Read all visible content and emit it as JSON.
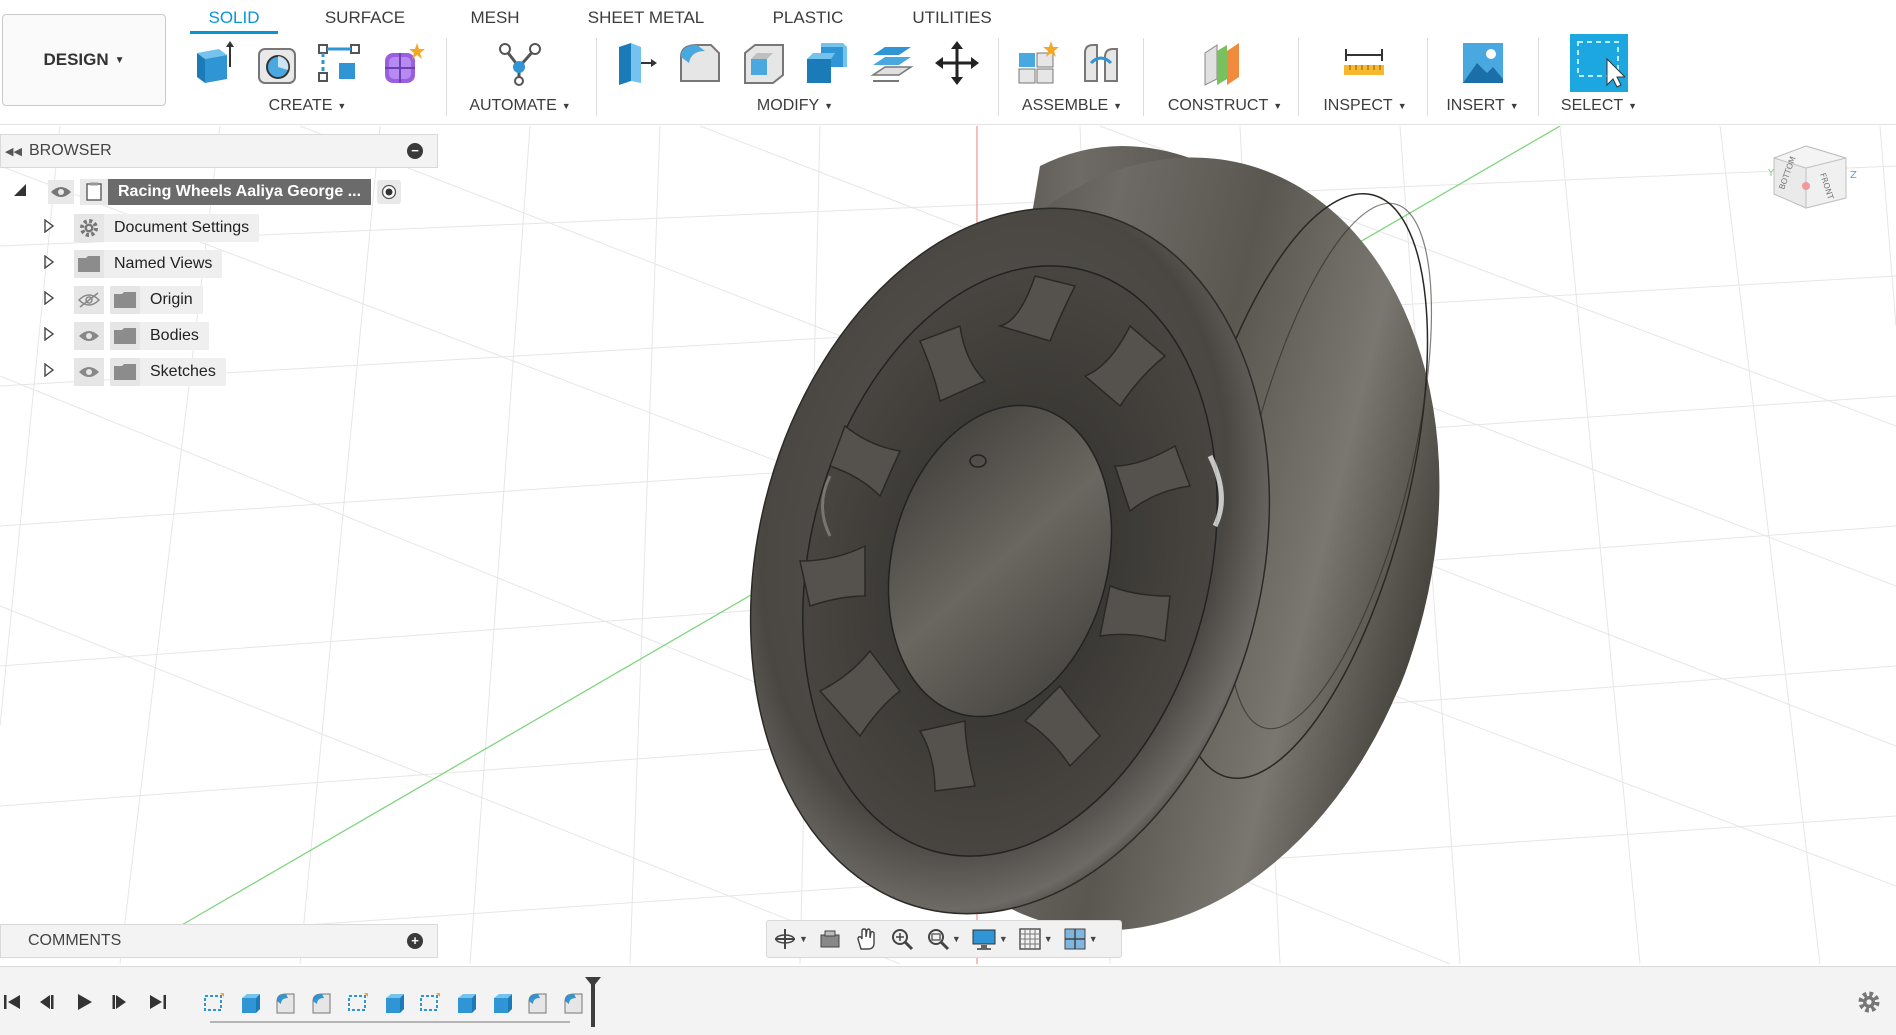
{
  "workspace": {
    "label": "DESIGN"
  },
  "tabs": [
    {
      "label": "SOLID",
      "active": true
    },
    {
      "label": "SURFACE",
      "active": false
    },
    {
      "label": "MESH",
      "active": false
    },
    {
      "label": "SHEET METAL",
      "active": false
    },
    {
      "label": "PLASTIC",
      "active": false
    },
    {
      "label": "UTILITIES",
      "active": false
    }
  ],
  "groups": [
    {
      "label": "CREATE"
    },
    {
      "label": "AUTOMATE"
    },
    {
      "label": "MODIFY"
    },
    {
      "label": "ASSEMBLE"
    },
    {
      "label": "CONSTRUCT"
    },
    {
      "label": "INSPECT"
    },
    {
      "label": "INSERT"
    },
    {
      "label": "SELECT"
    }
  ],
  "browser": {
    "title": "BROWSER",
    "root": "Racing Wheels Aaliya George ...",
    "items": [
      {
        "label": "Document Settings",
        "icon": "gear-icon"
      },
      {
        "label": "Named Views",
        "icon": "folder-icon"
      },
      {
        "label": "Origin",
        "icon": "folder-icon",
        "visible": false
      },
      {
        "label": "Bodies",
        "icon": "folder-icon",
        "visible": true
      },
      {
        "label": "Sketches",
        "icon": "folder-icon",
        "visible": true
      }
    ]
  },
  "comments": {
    "title": "COMMENTS"
  },
  "viewcube": {
    "faces": [
      "BOTTOM",
      "FRONT"
    ],
    "axes": [
      "Y",
      "Z"
    ]
  },
  "colors": {
    "accent": "#0696d7",
    "active_select": "#1da7e0"
  }
}
